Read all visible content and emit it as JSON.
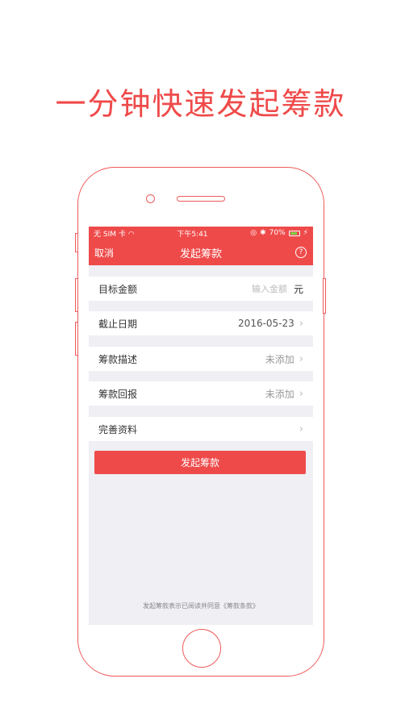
{
  "headline": "一分钟快速发起筹款",
  "status": {
    "carrier": "无 SIM 卡",
    "time": "下午5:41",
    "battery": "70%"
  },
  "nav": {
    "cancel": "取消",
    "title": "发起筹款",
    "help": "?"
  },
  "form": {
    "target": {
      "label": "目标金额",
      "placeholder": "输入金额",
      "unit": "元"
    },
    "deadline": {
      "label": "截止日期",
      "value": "2016-05-23"
    },
    "description": {
      "label": "筹款描述",
      "value": "未添加"
    },
    "reward": {
      "label": "筹款回报",
      "value": "未添加"
    },
    "profile": {
      "label": "完善资料"
    }
  },
  "submit": "发起筹款",
  "agreement": {
    "text": "发起筹款表示已阅读并同意",
    "link": "《筹款条款》"
  },
  "colors": {
    "accent": "#ef4a4a",
    "background": "#efeff4"
  }
}
